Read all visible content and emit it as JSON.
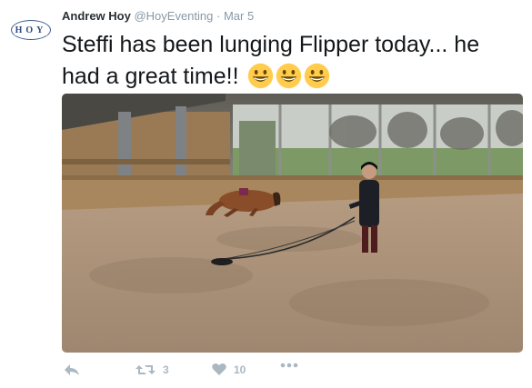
{
  "avatar": {
    "text": "HOY"
  },
  "author": {
    "name": "Andrew Hoy",
    "handle": "@HoyEventing",
    "separator": "·",
    "date": "Mar 5"
  },
  "tweet": {
    "text_line": "Steffi has been lunging Flipper today... he had a great time!!",
    "emojis": [
      "grinning-face",
      "grinning-face",
      "grinning-face"
    ]
  },
  "media": {
    "description_icon": "indoor-arena-photo"
  },
  "actions": {
    "reply_icon": "reply-icon",
    "retweet_count": "3",
    "like_count": "10",
    "more_icon": "more-icon"
  },
  "colors": {
    "text": "#14171a",
    "muted": "#8899a6",
    "action": "#aab8c2",
    "emoji": "#ffcc4d"
  }
}
